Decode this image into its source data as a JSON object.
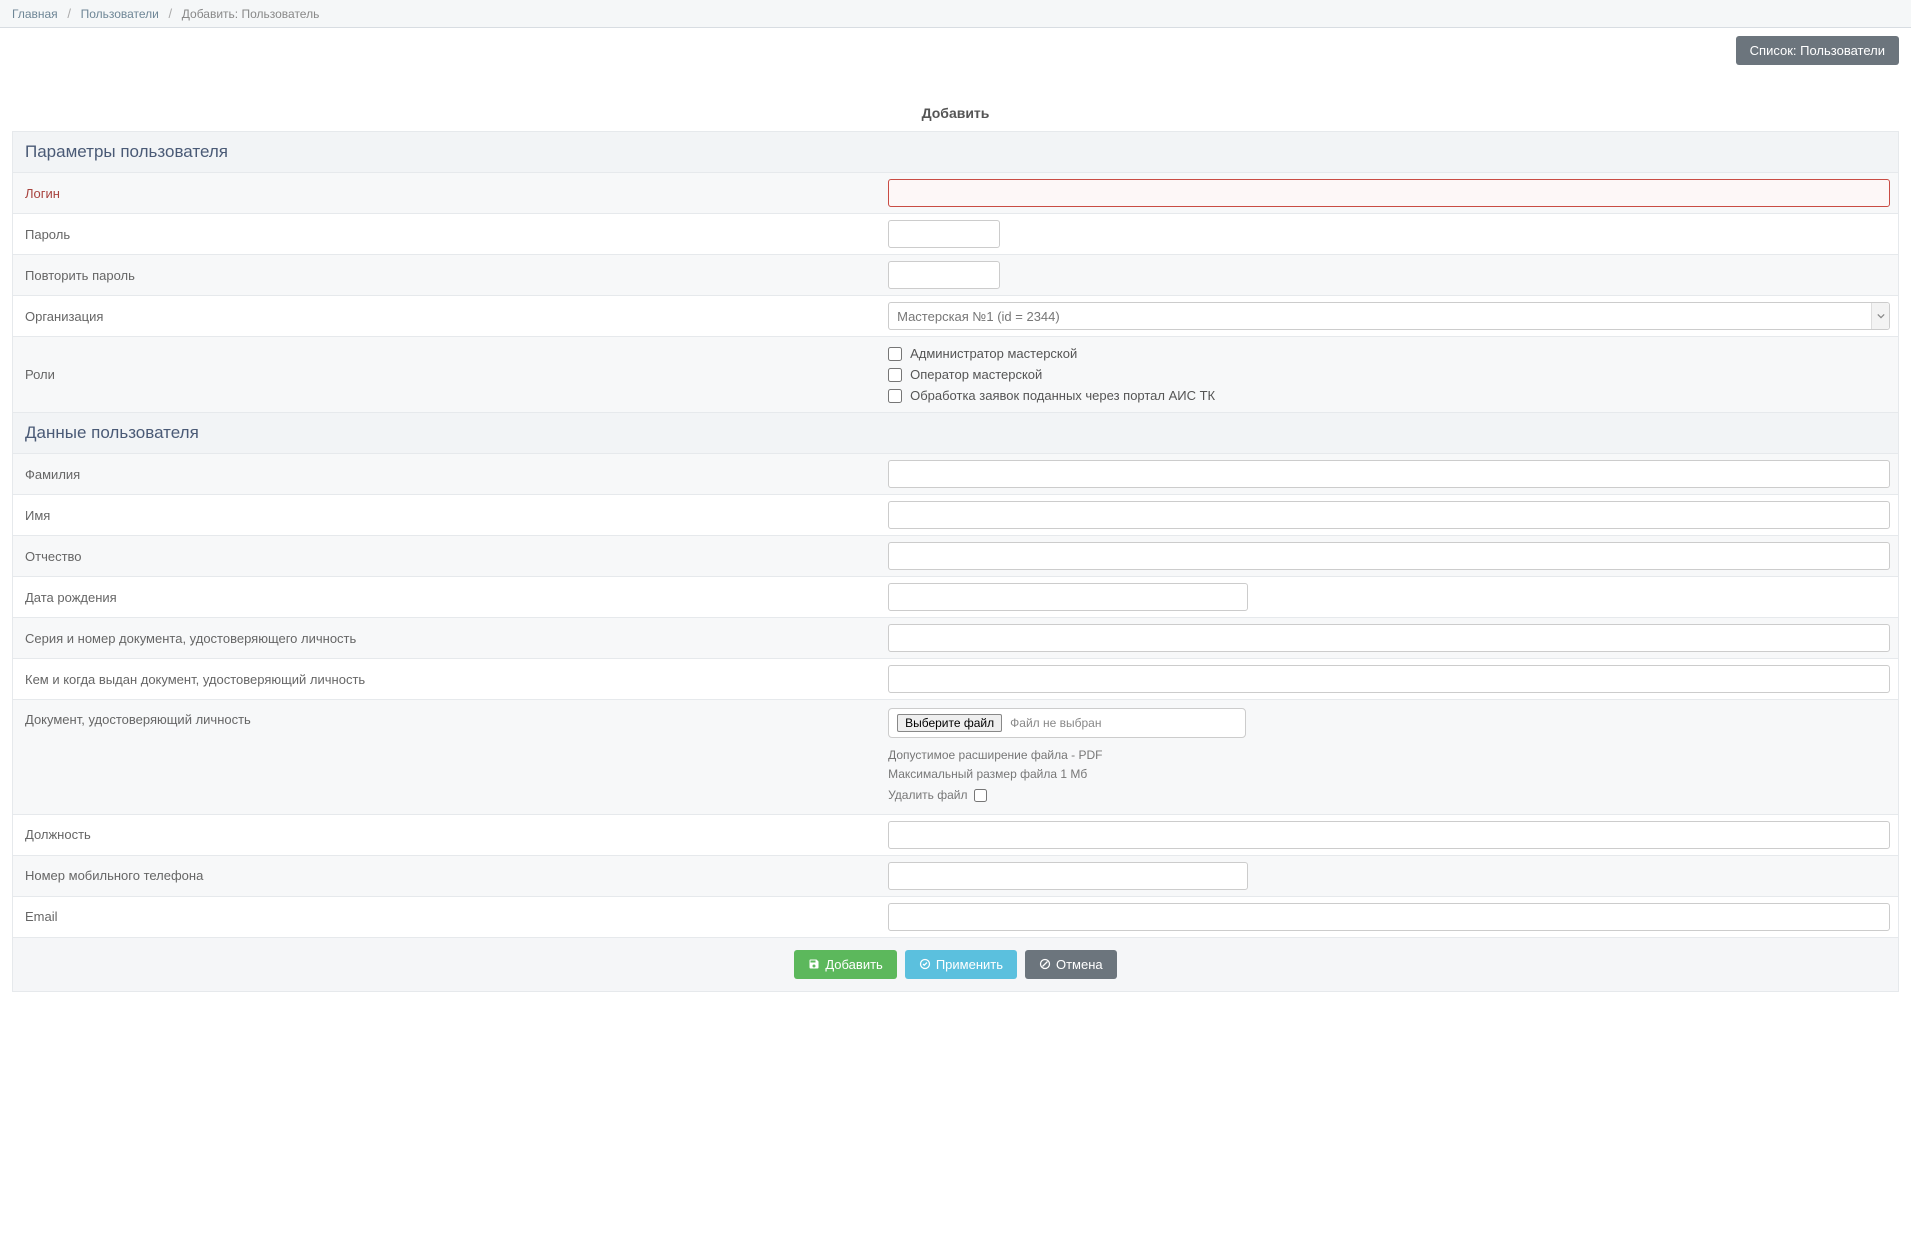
{
  "breadcrumb": {
    "home": "Главная",
    "users": "Пользователи",
    "current": "Добавить: Пользователь"
  },
  "topActions": {
    "listButton": "Список: Пользователи"
  },
  "pageTitle": "Добавить",
  "section1": {
    "header": "Параметры пользователя",
    "labels": {
      "login": "Логин",
      "password": "Пароль",
      "repeatPassword": "Повторить пароль",
      "organization": "Организация",
      "roles": "Роли"
    },
    "values": {
      "organization": "Мастерская №1 (id = 2344)"
    },
    "roleOptions": {
      "admin": "Администратор мастерской",
      "operator": "Оператор мастерской",
      "portal": "Обработка заявок поданных через портал АИС ТК"
    }
  },
  "section2": {
    "header": "Данные пользователя",
    "labels": {
      "lastname": "Фамилия",
      "firstname": "Имя",
      "middlename": "Отчество",
      "birthdate": "Дата рождения",
      "docSeries": "Серия и номер документа, удостоверяющего личность",
      "docIssued": "Кем и когда выдан документ, удостоверяющий личность",
      "docFile": "Документ, удостоверяющий личность",
      "position": "Должность",
      "mobile": "Номер мобильного телефона",
      "email": "Email"
    },
    "file": {
      "button": "Выберите файл",
      "status": "Файл не выбран",
      "hint1": "Допустимое расширение файла - PDF",
      "hint2": "Максимальный размер файла 1 Мб",
      "deleteLabel": "Удалить файл"
    }
  },
  "footer": {
    "add": "Добавить",
    "apply": "Применить",
    "cancel": "Отмена"
  }
}
